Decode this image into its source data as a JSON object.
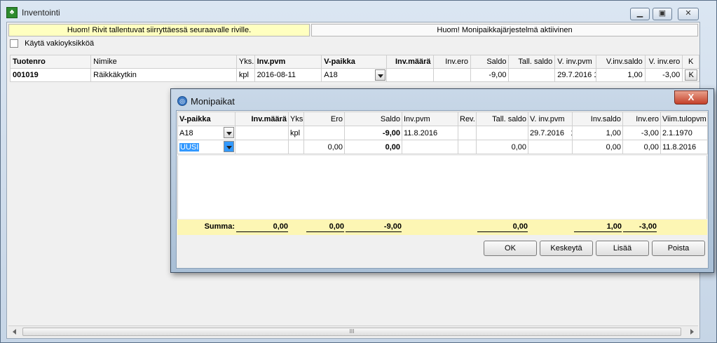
{
  "window": {
    "title": "Inventointi",
    "min_glyph": "▁",
    "max_glyph": "▣",
    "close_glyph": "✕"
  },
  "notices": {
    "left": "Huom! Rivit tallentuvat siirryttäessä seuraavalle riville.",
    "right": "Huom! Monipaikkajärjestelmä aktiivinen"
  },
  "checkbox": {
    "label": "Käytä vakioyksikköä",
    "checked": false
  },
  "main_grid": {
    "headers": [
      "Tuotenro",
      "Nimike",
      "Yks.",
      "Inv.pvm",
      "V-paikka",
      "Inv.määrä",
      "Inv.ero",
      "Saldo",
      "Tall. saldo",
      "V. inv.pvm",
      "V.inv.saldo",
      "V. inv.ero",
      "K"
    ],
    "row": {
      "tuotenro": "001019",
      "nimike": "Räikkäkytkin",
      "yks": "kpl",
      "inv_pvm": "2016-08-11",
      "v_paikka": "A18",
      "inv_maara": "",
      "inv_ero": "",
      "saldo": "-9,00",
      "tall_saldo": "",
      "v_inv_pvm": "29.7.2016 1",
      "v_inv_saldo": "1,00",
      "v_inv_ero": "-3,00",
      "k": "K"
    }
  },
  "scrollbar": {
    "grip": "III"
  },
  "dialog": {
    "title": "Monipaikat",
    "close_glyph": "X",
    "headers": [
      "V-paikka",
      "Inv.määrä",
      "Yks.",
      "Ero",
      "Saldo",
      "Inv.pvm",
      "Rev.",
      "Tall. saldo",
      "V. inv.pvm",
      "Inv.saldo",
      "Inv.ero",
      "Viim.tulopvm"
    ],
    "rows": [
      {
        "v_paikka": "A18",
        "inv_maara": "",
        "yks": "kpl",
        "ero": "",
        "saldo": "-9,00",
        "inv_pvm": "11.8.2016",
        "rev": "",
        "tall_saldo": "",
        "v_inv_pvm": "29.7.2016",
        "mark": "1",
        "inv_saldo": "1,00",
        "inv_ero": "-3,00",
        "viim_tulopvm": "2.1.1970"
      },
      {
        "v_paikka": "UUSI",
        "inv_maara": "",
        "yks": "",
        "ero": "0,00",
        "saldo": "0,00",
        "inv_pvm": "",
        "rev": "",
        "tall_saldo": "0,00",
        "v_inv_pvm": "",
        "mark": "",
        "inv_saldo": "0,00",
        "inv_ero": "0,00",
        "viim_tulopvm": "11.8.2016"
      }
    ],
    "summary": {
      "label": "Summa:",
      "inv_maara": "0,00",
      "ero": "0,00",
      "saldo": "-9,00",
      "tall_saldo": "0,00",
      "inv_saldo": "1,00",
      "inv_ero": "-3,00"
    },
    "buttons": {
      "ok": "OK",
      "cancel": "Keskeytä",
      "add": "Lisää",
      "delete": "Poista"
    }
  }
}
